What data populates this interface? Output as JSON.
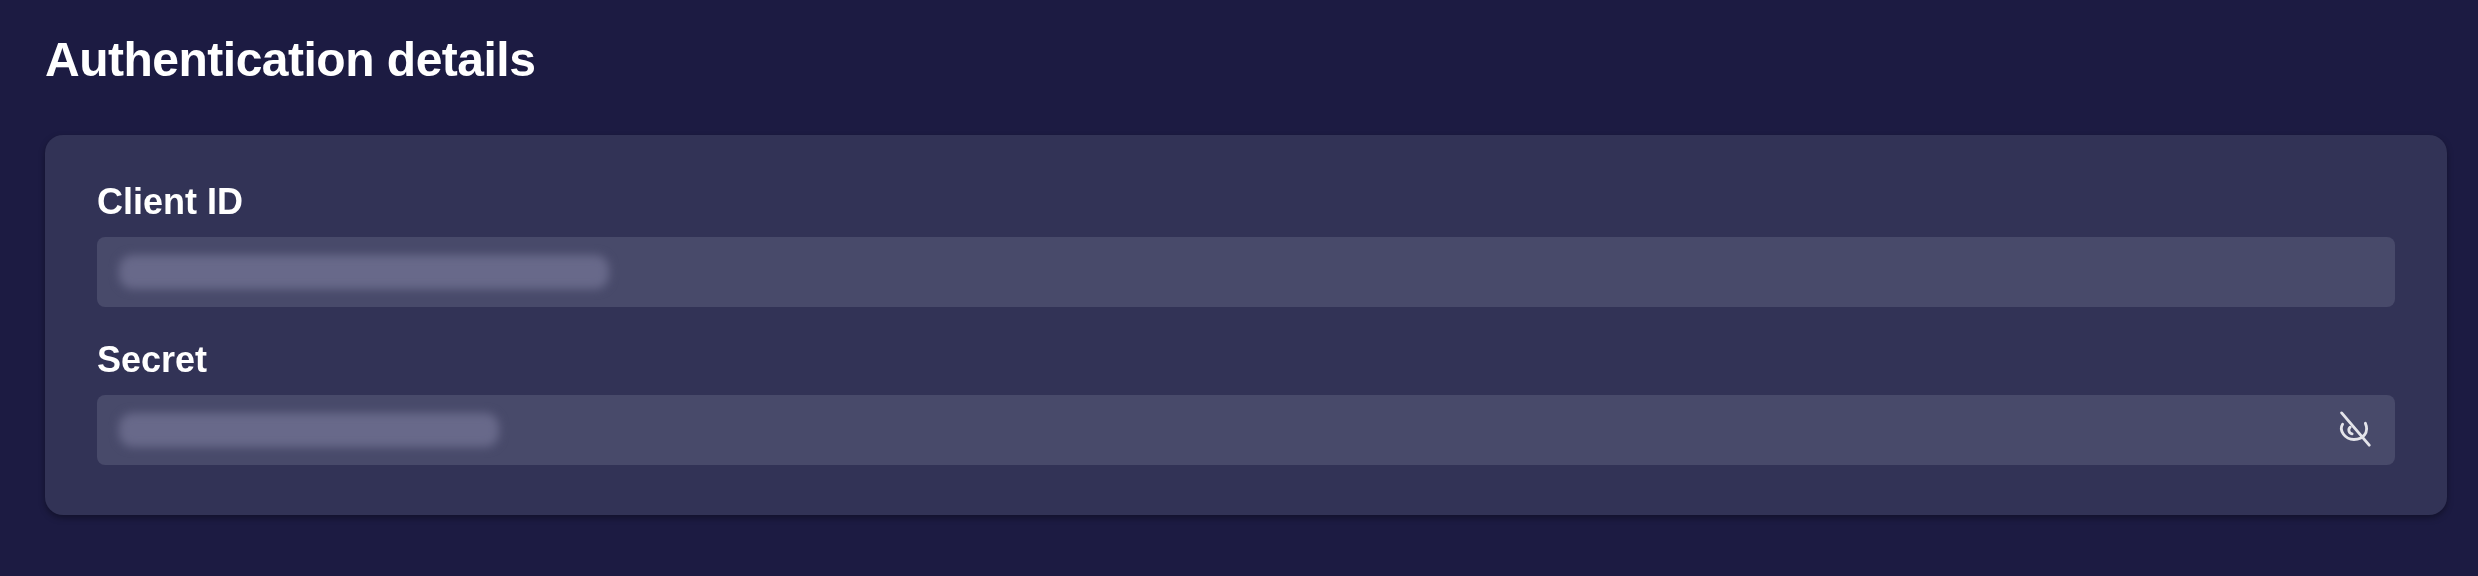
{
  "heading": "Authentication details",
  "fields": [
    {
      "label": "Client ID",
      "kind": "text",
      "blurred": true
    },
    {
      "label": "Secret",
      "kind": "secret",
      "blurred": true
    }
  ]
}
